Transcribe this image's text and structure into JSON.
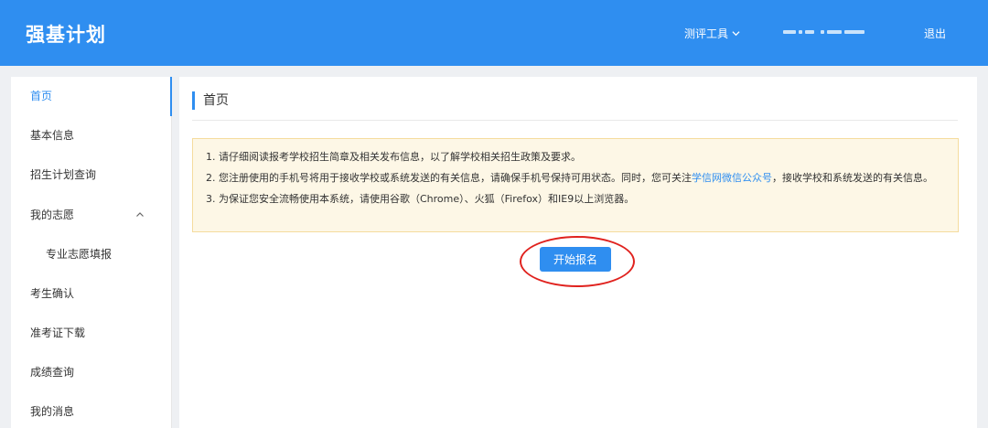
{
  "header": {
    "brand": "强基计划",
    "tools_menu": "测评工具",
    "logout": "退出"
  },
  "sidebar": {
    "items": [
      {
        "label": "首页"
      },
      {
        "label": "基本信息"
      },
      {
        "label": "招生计划查询"
      },
      {
        "label": "我的志愿"
      },
      {
        "label": "专业志愿填报"
      },
      {
        "label": "考生确认"
      },
      {
        "label": "准考证下载"
      },
      {
        "label": "成绩查询"
      },
      {
        "label": "我的消息"
      }
    ]
  },
  "main": {
    "title": "首页",
    "notice": {
      "line1": "1. 请仔细阅读报考学校招生简章及相关发布信息，以了解学校相关招生政策及要求。",
      "line2_before": "2. 您注册使用的手机号将用于接收学校或系统发送的有关信息，请确保手机号保持可用状态。同时，您可关注",
      "line2_link": "学信网微信公众号",
      "line2_after": "，接收学校和系统发送的有关信息。",
      "line3": "3. 为保证您安全流畅使用本系统，请使用谷歌（Chrome）、火狐（Firefox）和IE9以上浏览器。"
    },
    "start_button": "开始报名"
  },
  "colors": {
    "primary": "#2f8ef0",
    "notice_bg": "#fdf7e6",
    "notice_border": "#f5dc9e",
    "highlight": "#e0221e"
  }
}
